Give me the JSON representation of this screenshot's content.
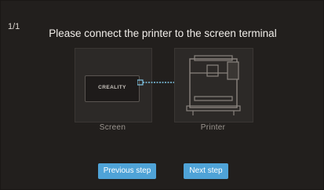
{
  "header": {
    "page_counter": "1/1",
    "title": "Please connect the printer to the screen terminal"
  },
  "panels": {
    "screen": {
      "label": "Screen",
      "device_logo": "CREALITY"
    },
    "printer": {
      "label": "Printer"
    }
  },
  "buttons": {
    "previous_label": "Previous step",
    "next_label": "Next step"
  },
  "colors": {
    "accent": "#4fa3d7",
    "cable": "#7fc6e6",
    "background": "#221f1d"
  }
}
